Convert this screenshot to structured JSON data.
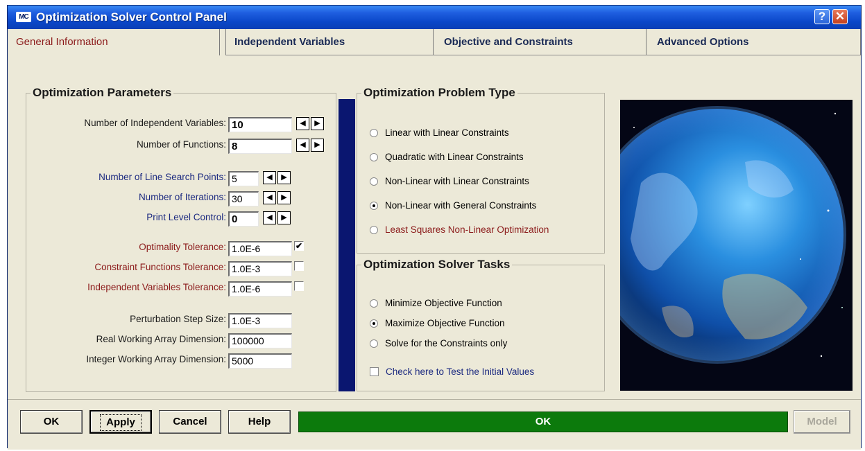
{
  "window": {
    "icon_text": "MC",
    "title": "Optimization Solver Control Panel",
    "help_glyph": "?",
    "close_glyph": "✕"
  },
  "tabs": [
    {
      "label": "General Information",
      "active": true
    },
    {
      "label": "Independent Variables",
      "active": false
    },
    {
      "label": "Objective and Constraints",
      "active": false
    },
    {
      "label": "Advanced Options",
      "active": false
    }
  ],
  "params": {
    "legend": "Optimization  Parameters",
    "fields": [
      {
        "label": "Number of Independent Variables:",
        "value": "10"
      },
      {
        "label": "Number of Functions:",
        "value": "8"
      },
      {
        "label": "Number of Line Search Points:",
        "value": "5"
      },
      {
        "label": "Number of Iterations:",
        "value": "30"
      },
      {
        "label": "Print Level Control:",
        "value": "0"
      },
      {
        "label": "Optimality Tolerance:",
        "value": "1.0E-6",
        "checked": true
      },
      {
        "label": "Constraint Functions Tolerance:",
        "value": "1.0E-3",
        "checked": false
      },
      {
        "label": "Independent Variables Tolerance:",
        "value": "1.0E-6",
        "checked": false
      },
      {
        "label": "Perturbation Step Size:",
        "value": "1.0E-3"
      },
      {
        "label": "Real Working Array Dimension:",
        "value": "100000"
      },
      {
        "label": "Integer Working Array Dimension:",
        "value": "5000"
      }
    ],
    "check_glyph": "✔",
    "spin_left_glyph": "◀",
    "spin_right_glyph": "▶"
  },
  "problem_type": {
    "legend": "Optimization Problem Type",
    "options": [
      "Linear with Linear Constraints",
      "Quadratic with Linear Constraints",
      "Non-Linear with Linear Constraints",
      "Non-Linear with General Constraints",
      "Least Squares Non-Linear Optimization"
    ],
    "selected_index": 3
  },
  "solver_tasks": {
    "legend": "Optimization Solver Tasks",
    "options": [
      "Minimize Objective Function",
      "Maximize Objective Function",
      "Solve for the Constraints only"
    ],
    "selected_index": 1,
    "test_initial_label": "Check here to Test the Initial Values",
    "test_initial_checked": false
  },
  "buttons": {
    "ok": "OK",
    "apply": "Apply",
    "cancel": "Cancel",
    "help": "Help",
    "model": "Model"
  },
  "status": {
    "text": "OK",
    "color": "#0c7a0c"
  },
  "colors": {
    "titlebar": "#0a46c8",
    "label_blue": "#1c2a80",
    "label_red": "#8b1a1a",
    "accent_bar": "#0a1670"
  }
}
